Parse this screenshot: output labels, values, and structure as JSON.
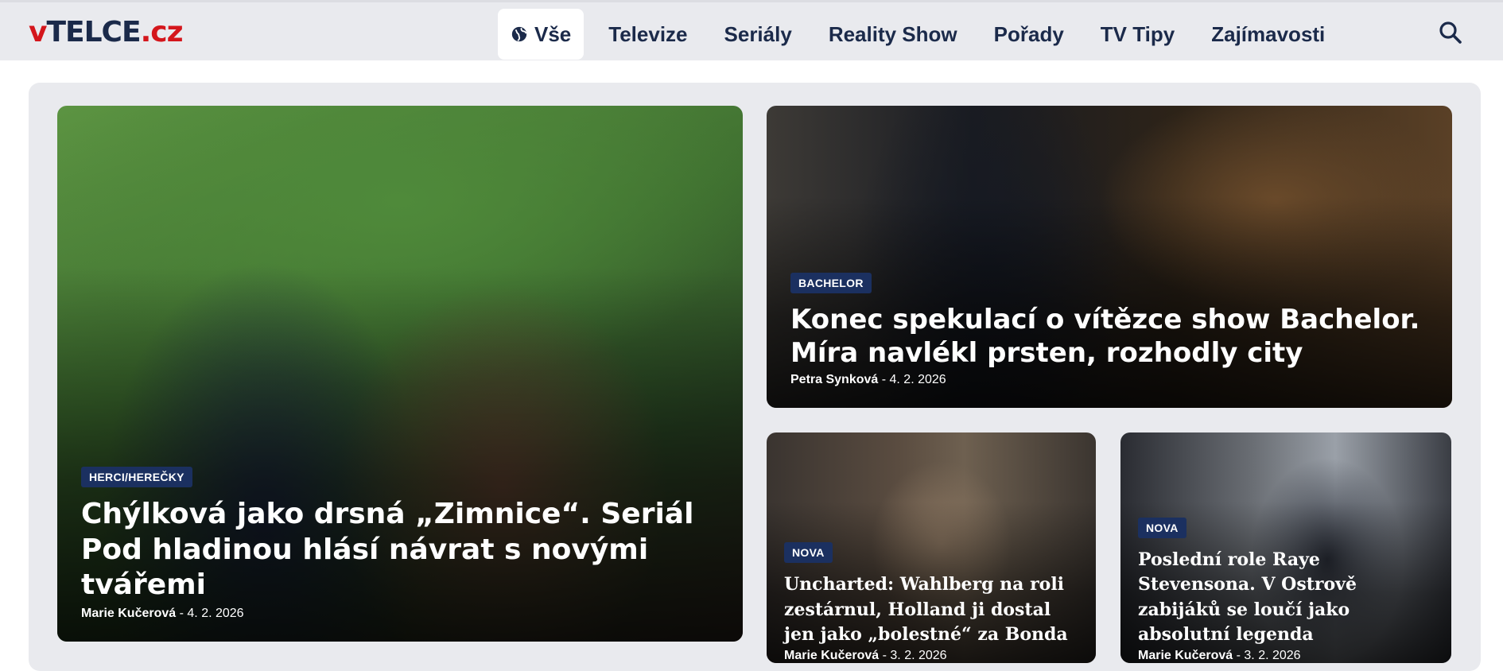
{
  "header": {
    "logo": {
      "prefix": "v",
      "main": "TELCE",
      "suffix": ".cz"
    },
    "nav": [
      {
        "label": "Vše",
        "icon": "globe-icon",
        "active": true
      },
      {
        "label": "Televize"
      },
      {
        "label": "Seriály"
      },
      {
        "label": "Reality Show"
      },
      {
        "label": "Pořady"
      },
      {
        "label": "TV Tipy"
      },
      {
        "label": "Zajímavosti"
      }
    ],
    "search_icon": "search-icon"
  },
  "articles": {
    "main": {
      "badge": "HERCI/HEREČKY",
      "title": "Chýlková jako drsná „Zimnice“. Seriál Pod hladinou hlásí návrat s novými tvářemi",
      "author": "Marie Kučerová",
      "date": "4. 2. 2026"
    },
    "top_right": {
      "badge": "BACHELOR",
      "title": "Konec spekulací o vítězce show Bachelor. Míra navlékl prsten, rozhodly city",
      "author": "Petra Synková",
      "date": "4. 2. 2026"
    },
    "bottom_left": {
      "badge": "NOVA",
      "title": "Uncharted: Wahlberg na roli zestárnul, Holland ji dostal jen jako „bolestné“ za Bonda",
      "author": "Marie Kučerová",
      "date": "3. 2. 2026"
    },
    "bottom_right": {
      "badge": "NOVA",
      "title": "Poslední role Raye Stevensona. V Ostrově zabijáků se loučí jako absolutní legenda",
      "author": "Marie Kučerová",
      "date": "3. 2. 2026"
    }
  },
  "colors": {
    "brand_red": "#d4161c",
    "navy": "#1b2a4a",
    "badge_bg": "#1b3060",
    "header_bg": "#e9eaee"
  },
  "meta_separator": "-"
}
